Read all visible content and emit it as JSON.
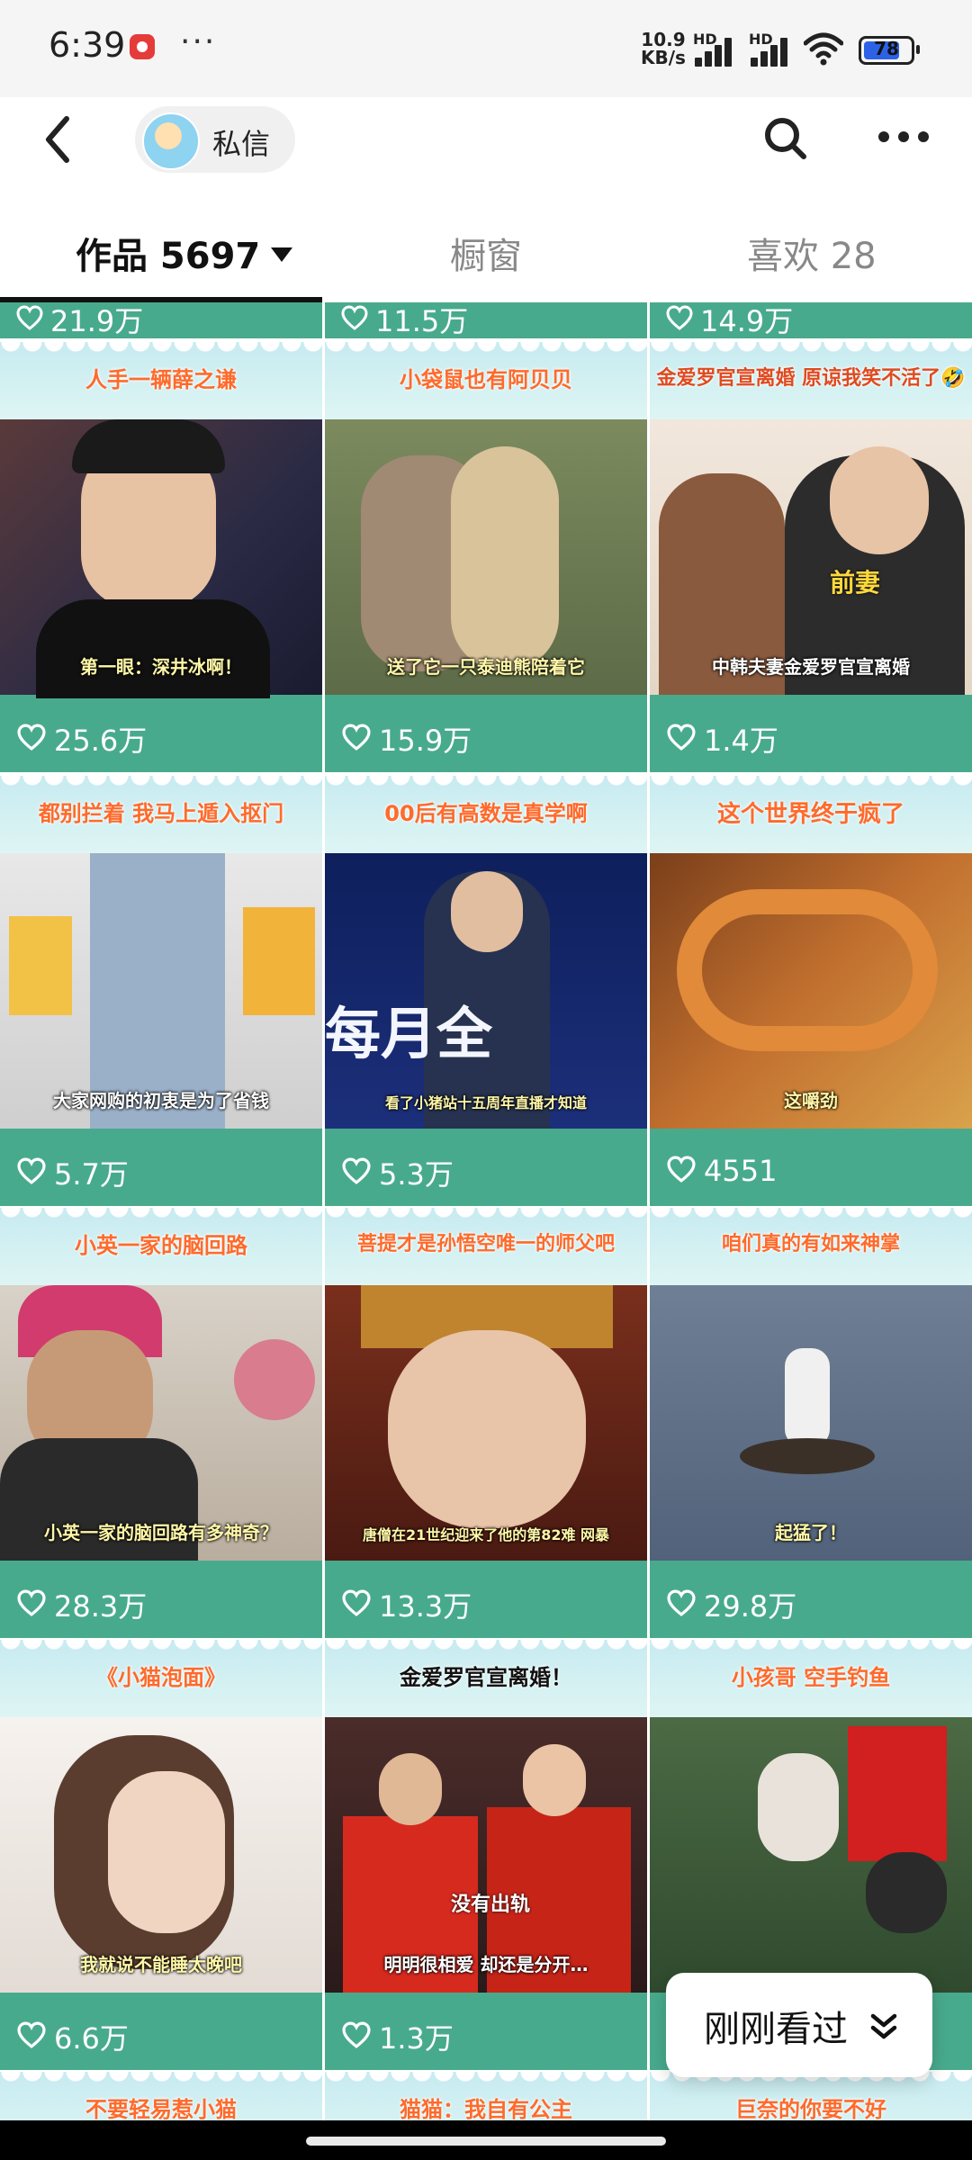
{
  "status_bar": {
    "time": "6:39",
    "more": "···",
    "speed_value": "10.9",
    "speed_unit": "KB/s",
    "hd1": "HD",
    "hd2": "HD",
    "battery": "78",
    "battery_level": 0.78
  },
  "header": {
    "back_icon": "chevron-left-icon",
    "dm_label": "私信",
    "search_icon": "search-icon",
    "more_icon": "more-horizontal-icon"
  },
  "tabs": {
    "works_label": "作品 5697",
    "showcase_label": "橱窗",
    "likes_label": "喜欢 28"
  },
  "top_partial": [
    {
      "likes": "21.9万"
    },
    {
      "likes": "11.5万"
    },
    {
      "likes": "14.9万"
    }
  ],
  "videos": [
    {
      "title": "人手一辆薛之谦",
      "subtitle": "第一眼：深井冰啊！",
      "likes": "25.6万"
    },
    {
      "title": "小袋鼠也有阿贝贝",
      "subtitle": "送了它一只泰迪熊陪着它",
      "likes": "15.9万"
    },
    {
      "title": "金爱罗官宣离婚 原谅我笑不活了🤣",
      "subtitle": "中韩夫妻金爱罗官宣离婚",
      "overlay": "前妻",
      "likes": "1.4万"
    },
    {
      "title": "都别拦着 我马上遁入抠门",
      "subtitle": "大家网购的初衷是为了省钱",
      "likes": "5.7万"
    },
    {
      "title": "00后有高数是真学啊",
      "subtitle": "看了小猪站十五周年直播才知道",
      "overlay": "每月全",
      "likes": "5.3万"
    },
    {
      "title": "这个世界终于疯了",
      "subtitle": "这嚼劲",
      "likes": "4551"
    },
    {
      "title": "小英一家的脑回路",
      "subtitle": "小英一家的脑回路有多神奇？",
      "likes": "28.3万"
    },
    {
      "title": "菩提才是孙悟空唯一的师父吧",
      "subtitle": "唐僧在21世纪迎来了他的第82难 网暴",
      "likes": "13.3万"
    },
    {
      "title": "咱们真的有如来神掌",
      "subtitle": "起猛了！",
      "likes": "29.8万"
    },
    {
      "title": "《小猫泡面》",
      "subtitle": "我就说不能睡太晚吧",
      "likes": "6.6万"
    },
    {
      "title": "金爱罗官宣离婚！",
      "subtitle": "明明很相爱 却还是分开…",
      "overlay": "没有出轨",
      "likes": "1.3万"
    },
    {
      "title": "小孩哥 空手钓鱼",
      "subtitle": "",
      "likes": ""
    }
  ],
  "bottom_partial": [
    {
      "title": "不要轻易惹小猫"
    },
    {
      "title": "猫猫：我自有公主"
    },
    {
      "title": "巨奈的你要不好"
    }
  ],
  "watched": {
    "label": "刚刚看过",
    "icon": "double-chevron-down-icon"
  }
}
